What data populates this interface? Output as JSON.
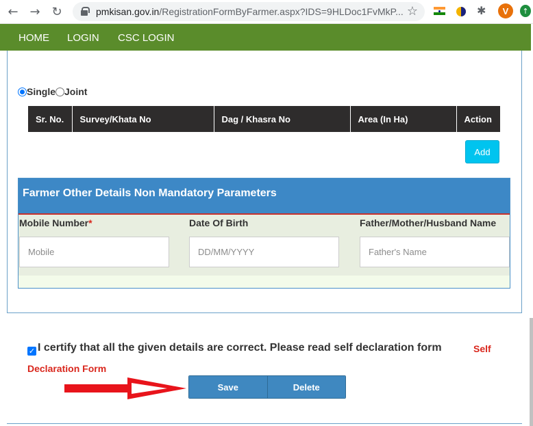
{
  "browser": {
    "url_host": "pmkisan.gov.in",
    "url_path": "/RegistrationFormByFarmer.aspx?IDS=9HLDoc1FvMkP...",
    "avatar_letter": "V"
  },
  "nav": {
    "items": [
      "HOME",
      "LOGIN",
      "CSC LOGIN"
    ]
  },
  "ownership": {
    "options": [
      "Single",
      "Joint"
    ],
    "selected": "Single"
  },
  "land_table": {
    "headers": [
      "Sr. No.",
      "Survey/Khata No",
      "Dag / Khasra No",
      "Area (In Ha)",
      "Action"
    ]
  },
  "add_button": "Add",
  "other_details": {
    "title": "Farmer Other Details Non Mandatory Parameters",
    "fields": [
      {
        "label": "Mobile Number",
        "required_mark": "*",
        "placeholder": "Mobile"
      },
      {
        "label": "Date Of Birth",
        "required_mark": "",
        "placeholder": "DD/MM/YYYY"
      },
      {
        "label": "Father/Mother/Husband Name",
        "required_mark": "",
        "placeholder": "Father's Name"
      }
    ]
  },
  "declaration": {
    "checked": true,
    "text": "I certify that all the given details are correct. Please read self declaration form",
    "link_part1": "Self",
    "link_part2": "Declaration Form"
  },
  "actions": {
    "save": "Save",
    "delete": "Delete"
  },
  "colors": {
    "nav_green": "#5a8c2b",
    "header_blue": "#3d88c6",
    "button_blue": "#3f88c0",
    "add_cyan": "#00c4ef",
    "link_red": "#d9261c",
    "arrow_red": "#e8141b"
  },
  "icons": [
    "back-arrow-icon",
    "forward-arrow-icon",
    "reload-icon",
    "lock-icon",
    "star-icon",
    "india-flag-icon",
    "extension-icon",
    "puzzle-icon",
    "update-icon",
    "red-pointer-arrow-icon"
  ]
}
